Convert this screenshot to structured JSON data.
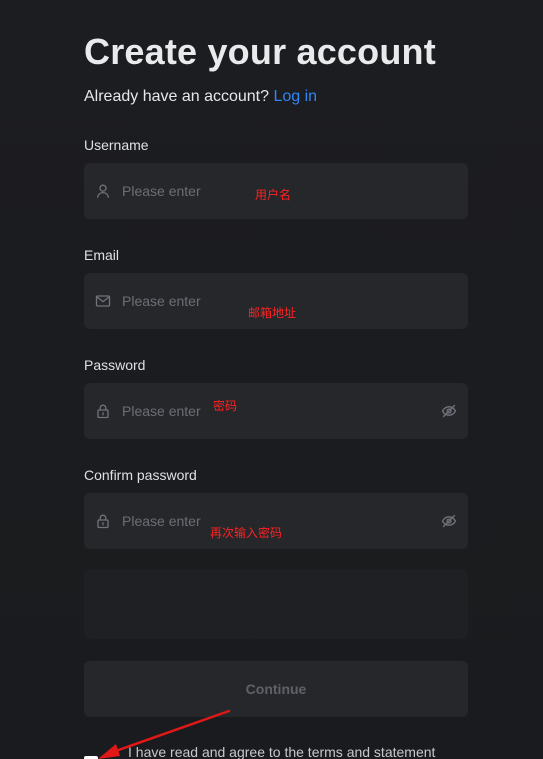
{
  "header": {
    "title": "Create your account",
    "subtitle_prefix": "Already have an account?",
    "login_link": "Log in"
  },
  "form": {
    "username": {
      "label": "Username",
      "placeholder": "Please enter",
      "icon": "user-icon",
      "annotation": "用户名"
    },
    "email": {
      "label": "Email",
      "placeholder": "Please enter",
      "icon": "mail-icon",
      "annotation": "邮箱地址"
    },
    "password": {
      "label": "Password",
      "placeholder": "Please enter",
      "icon": "lock-icon",
      "annotation": "密码"
    },
    "confirm_password": {
      "label": "Confirm password",
      "placeholder": "Please enter",
      "icon": "lock-icon",
      "annotation": "再次输入密码"
    },
    "continue_label": "Continue",
    "agreement_text": "I have read and agree to the terms and statement"
  },
  "colors": {
    "background": "#1b1c1f",
    "field": "#25272b",
    "link": "#2f86f6",
    "annotation": "#ff2222"
  }
}
